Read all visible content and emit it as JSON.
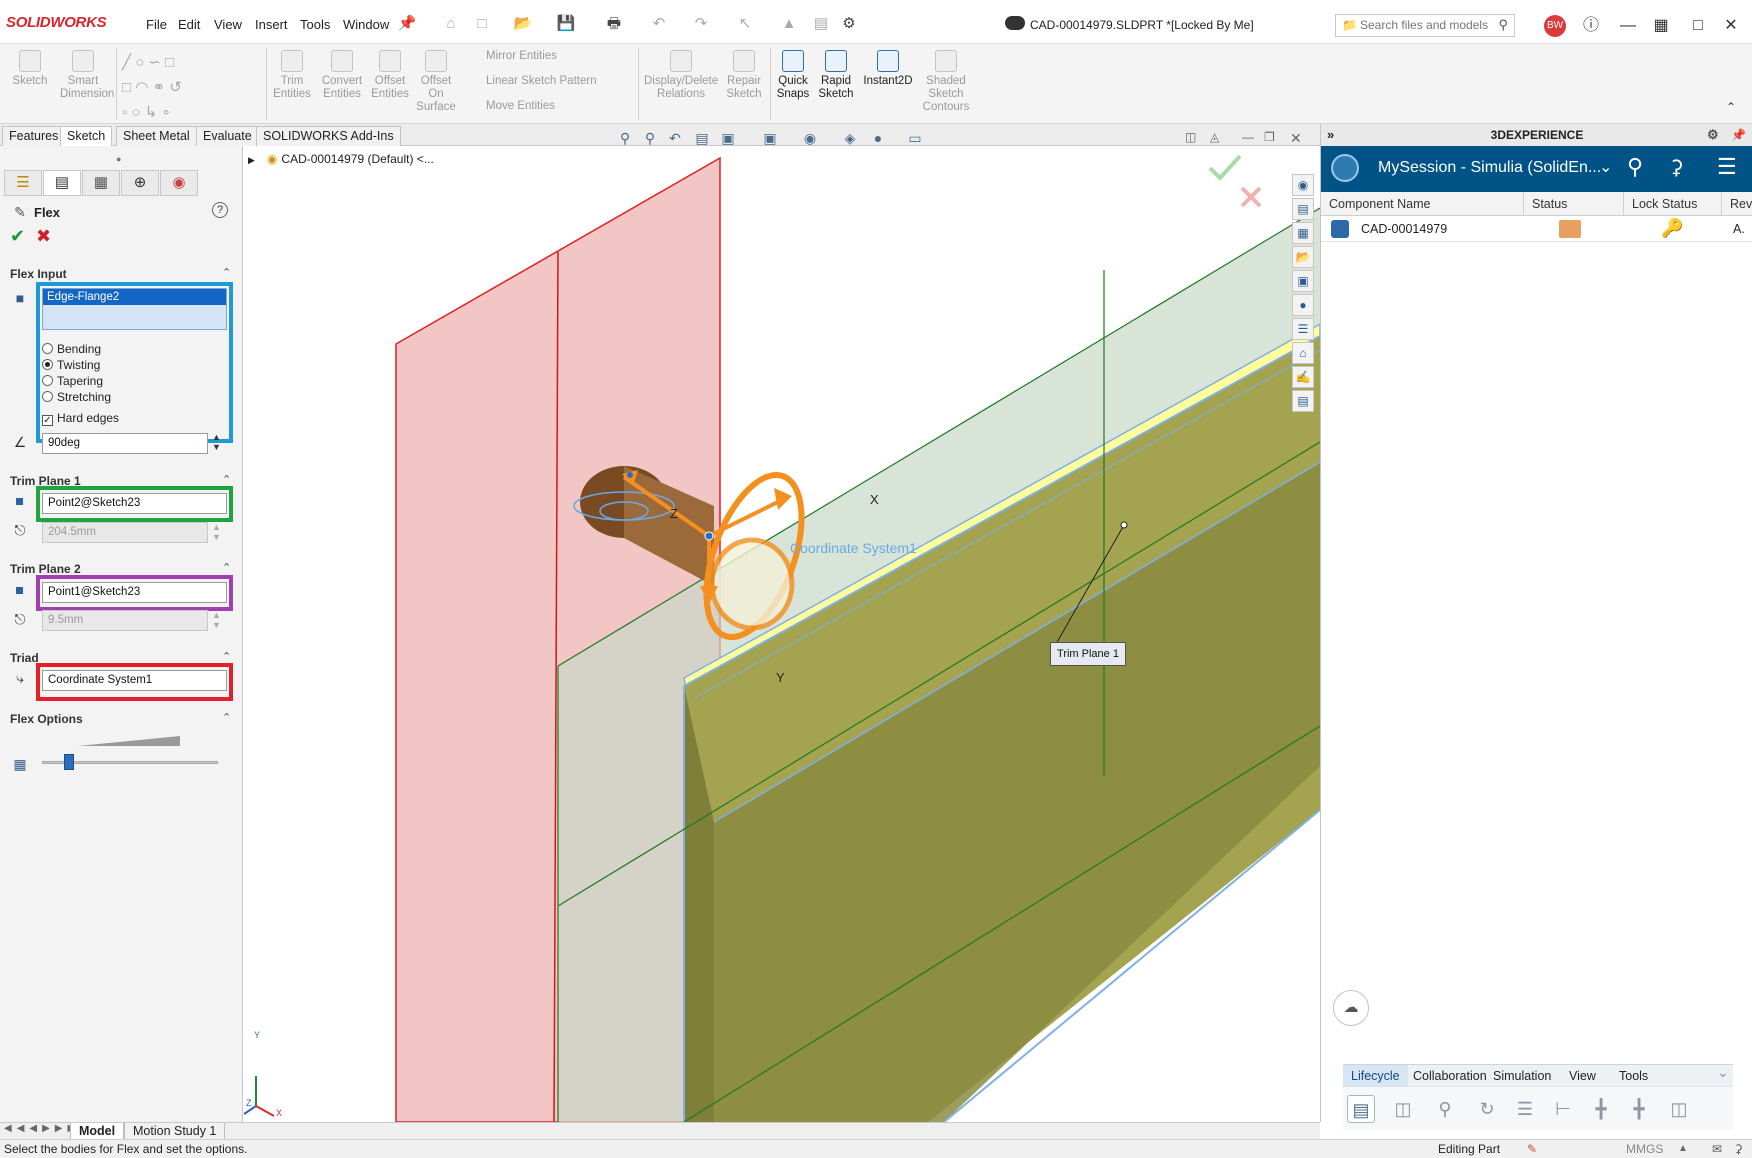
{
  "app": {
    "logo_text": "SOLIDWORKS",
    "document_title": "CAD-00014979.SLDPRT *[Locked By Me]",
    "menus": [
      "File",
      "Edit",
      "View",
      "Insert",
      "Tools",
      "Window"
    ],
    "search_placeholder": "Search files and models",
    "user_initials": "BW"
  },
  "ribbon": {
    "sketch": "Sketch",
    "smart_dimension": "Smart Dimension",
    "trim_entities": "Trim Entities",
    "convert_entities": "Convert Entities",
    "offset_entities": "Offset Entities",
    "offset_on_surface": "Offset On Surface",
    "mirror_entities": "Mirror Entities",
    "linear_sketch_pattern": "Linear Sketch Pattern",
    "move_entities": "Move Entities",
    "display_delete_relations": "Display/Delete Relations",
    "repair_sketch": "Repair Sketch",
    "quick_snaps": "Quick Snaps",
    "rapid_sketch": "Rapid Sketch",
    "instant2d": "Instant2D",
    "shaded_sketch_contours": "Shaded Sketch Contours"
  },
  "tabs": [
    "Features",
    "Sketch",
    "Sheet Metal",
    "Evaluate",
    "SOLIDWORKS Add-Ins"
  ],
  "active_tab": "Sketch",
  "property_manager": {
    "title": "Flex",
    "flex_input": {
      "header": "Flex Input",
      "selected_body": "Edge-Flange2",
      "options": [
        "Bending",
        "Twisting",
        "Tapering",
        "Stretching"
      ],
      "selected_option": "Twisting",
      "hard_edges_label": "Hard edges",
      "hard_edges_checked": true,
      "angle": "90deg"
    },
    "trim_plane_1": {
      "header": "Trim Plane 1",
      "point": "Point2@Sketch23",
      "distance": "204.5mm"
    },
    "trim_plane_2": {
      "header": "Trim Plane 2",
      "point": "Point1@Sketch23",
      "distance": "9.5mm"
    },
    "triad": {
      "header": "Triad",
      "coordinate_system": "Coordinate System1"
    },
    "flex_options": {
      "header": "Flex Options",
      "accuracy_level": 0.13
    },
    "highlight_colors": {
      "flex_input": "#1f9ad6",
      "trim_plane_1": "#1fa540",
      "trim_plane_2": "#a040b0",
      "triad": "#e0202a"
    }
  },
  "viewport": {
    "breadcrumb": "CAD-00014979 (Default) <...",
    "trim_plane_label": "Trim Plane 1",
    "coordinate_label": "Coordinate System1",
    "axis_labels": {
      "x": "X",
      "y": "Y",
      "z": "Z"
    }
  },
  "experience_panel": {
    "header": "3DEXPERIENCE",
    "session": "MySession - Simulia (SolidEn...",
    "columns": [
      "Component Name",
      "Status",
      "Lock Status",
      "Rev"
    ],
    "rows": [
      {
        "component_name": "CAD-00014979",
        "rev": "A."
      }
    ],
    "lifecycle_tabs": [
      "Lifecycle",
      "Collaboration",
      "Simulation",
      "View",
      "Tools"
    ],
    "active_lifecycle_tab": "Lifecycle"
  },
  "bottom_tabs": [
    "Model",
    "Motion Study 1"
  ],
  "status": {
    "message": "Select the bodies for Flex and set the options.",
    "mode": "Editing Part",
    "units": "MMGS"
  }
}
